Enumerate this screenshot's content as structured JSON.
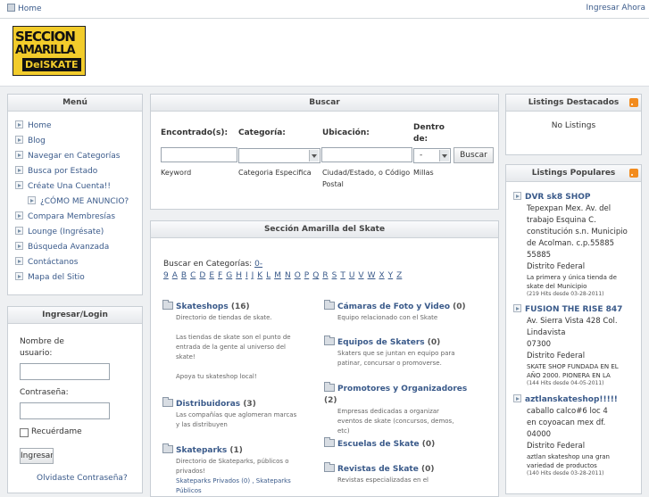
{
  "topbar": {
    "home": "Home",
    "login": "Ingresar Ahora"
  },
  "logo": {
    "line1": "SECCION",
    "line2": "AMARILLA",
    "line3": "DelSKATE"
  },
  "menu": {
    "title": "Menú",
    "items": [
      "Home",
      "Blog",
      "Navegar en Categorías",
      "Busca por Estado",
      "Créate Una Cuenta!!",
      "¿CÓMO ME ANUNCIO?",
      "Compara Membresías",
      "Lounge (Ingrésate)",
      "Búsqueda Avanzada",
      "Contáctanos",
      "Mapa del Sitio"
    ]
  },
  "login": {
    "title": "Ingresar/Login",
    "username_label_1": "Nombre de",
    "username_label_2": "usuario:",
    "password_label": "Contraseña:",
    "remember_label": "Recuérdame",
    "submit_label": "Ingresar",
    "forgot": "Olvidaste Contraseña?"
  },
  "search": {
    "title": "Buscar",
    "col1": "Encontrado(s):",
    "col2": "Categoría:",
    "col3": "Ubicación:",
    "col4_1": "Dentro",
    "col4_2": "de:",
    "distance_value": "-",
    "button": "Buscar",
    "hint1": "Keyword",
    "hint2": "Categoria Especifica",
    "hint3_1": "Ciudad/Estado, o Código",
    "hint3_2": "Postal",
    "hint4": "Millas"
  },
  "main": {
    "title": "Sección Amarilla del Skate",
    "browse_label": "Buscar en Categorías:",
    "letters": [
      "0-9",
      "A",
      "B",
      "C",
      "D",
      "E",
      "F",
      "G",
      "H",
      "I",
      "J",
      "K",
      "L",
      "M",
      "N",
      "O",
      "P",
      "Q",
      "R",
      "S",
      "T",
      "U",
      "V",
      "W",
      "X",
      "Y",
      "Z"
    ],
    "categories_left": [
      {
        "name": "Skateshops",
        "count": "(16)",
        "desc": [
          "Directorio de tiendas de skate.",
          "",
          "Las tiendas de skate son el punto de",
          "entrada de la gente al universo del",
          "skate!",
          "",
          "Apoya tu skateshop local!"
        ],
        "sub": ""
      },
      {
        "name": "Distribuidoras",
        "count": "(3)",
        "desc": [
          "Las compañías que aglomeran marcas",
          "y las distribuyen"
        ],
        "sub": ""
      },
      {
        "name": "Skateparks",
        "count": "(1)",
        "desc": [
          "Directorio de Skateparks, públicos o",
          "privados!"
        ],
        "sub": "Skateparks Privados   (0) , Skateparks Públicos"
      }
    ],
    "categories_right": [
      {
        "name": "Cámaras de Foto y Video",
        "count": "(0)",
        "desc": [
          "Equipo relacionado con el Skate"
        ]
      },
      {
        "name": "Equipos de Skaters",
        "count": "(0)",
        "desc": [
          "Skaters que se juntan en equipo para",
          "patinar, concursar o promoverse."
        ]
      },
      {
        "name": "Promotores y Organizadores",
        "count": "(2)",
        "desc": [
          "Empresas dedicadas a organizar",
          "eventos de skate (concursos, demos,",
          "etc)"
        ]
      },
      {
        "name": "Escuelas de Skate",
        "count": "(0)",
        "desc": []
      },
      {
        "name": "Revistas de Skate",
        "count": "(0)",
        "desc": [
          "Revistas especializadas en el"
        ]
      }
    ]
  },
  "featured": {
    "title": "Listings Destacados",
    "empty": "No Listings"
  },
  "popular": {
    "title": "Listings Populares",
    "items": [
      {
        "name": "DVR sk8 SHOP",
        "addr": [
          "Tepexpan Mex. Av. del",
          "trabajo Esquina C.",
          "constitución s.n. Municipio",
          "de Acolman. c.p.55885",
          "55885",
          "Distrito Federal"
        ],
        "desc": [
          "La primera y única tienda de",
          "skate del Municipio"
        ],
        "hits": "(219 Hits desde 03-28-2011)"
      },
      {
        "name": "FUSION THE RISE 847",
        "addr": [
          "Av. Sierra Vista 428 Col.",
          "Lindavista",
          "07300",
          "Distrito Federal"
        ],
        "desc": [
          "SKATE SHOP FUNDADA EN EL",
          "AÑO 2000. PIONERA EN LA"
        ],
        "hits": "(144 Hits desde 04-05-2011)"
      },
      {
        "name": "aztlanskateshop!!!!!",
        "addr": [
          "caballo calco#6 loc 4",
          "en coyoacan mex df.",
          "04000",
          "Distrito Federal"
        ],
        "desc": [
          "aztlan skateshop una gran",
          "variedad de productos"
        ],
        "hits": "(140 Hits desde 03-28-2011)"
      }
    ]
  }
}
